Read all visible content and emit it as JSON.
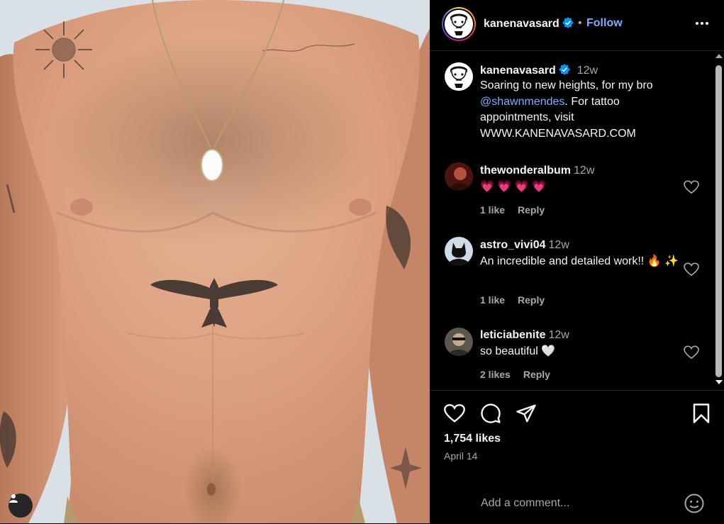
{
  "post": {
    "author": "kanenavasard",
    "follow_label": "Follow",
    "dot": "•",
    "caption_time": "12w",
    "caption_part1": "Soaring to new heights, for my bro ",
    "caption_mention": "@shawnmendes",
    "caption_part2": ". For tattoo appointments, visit WWW.KANENAVASARD.COM",
    "likes": "1,754 likes",
    "date": "April 14"
  },
  "comments": [
    {
      "user": "thewonderalbum",
      "time": "12w",
      "text": "💗 💗 💗 💗",
      "likes": "1 like",
      "reply": "Reply"
    },
    {
      "user": "astro_vivi04",
      "time": "12w",
      "text": "An incredible and detailed work!! 🔥 ✨",
      "likes": "1 like",
      "reply": "Reply"
    },
    {
      "user": "leticiabenite",
      "time": "12w",
      "text": "so beautiful 🤍",
      "likes": "2 likes",
      "reply": "Reply"
    }
  ],
  "composer": {
    "placeholder": "Add a comment..."
  },
  "colors": {
    "accent": "#85a8ff",
    "verified": "#0095f6",
    "muted": "#a8a8a8"
  },
  "icons": [
    "verified-badge-icon",
    "more-options-icon",
    "heart-icon",
    "comment-icon",
    "share-icon",
    "bookmark-icon",
    "emoji-icon",
    "user-tag-icon"
  ]
}
